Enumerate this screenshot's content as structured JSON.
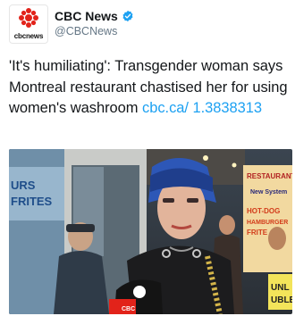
{
  "account": {
    "logo_text": "cbcnews",
    "display_name": "CBC News",
    "handle": "@CBCNews",
    "verified_icon": "verified-badge-icon"
  },
  "tweet": {
    "text": "'It's humiliating': Transgender woman says Montreal restaurant chastised her for using women's washroom ",
    "link": "cbc.ca/ 1.3838313"
  },
  "photo": {
    "storefront_letters_left": "URS FRITES",
    "sign_restaurant": "RESTAURANT",
    "sign_system": "New System Sai-b-u",
    "sign_hotdog": "HOT-DOG",
    "sign_hamburger": "HAMBURGER",
    "sign_frite": "FRITE",
    "sign_right": "UNL UBLE",
    "mic_label": "CBC"
  },
  "colors": {
    "brand_red": "#e2231a",
    "link_blue": "#1da1f2",
    "verified_blue": "#1da1f2"
  }
}
